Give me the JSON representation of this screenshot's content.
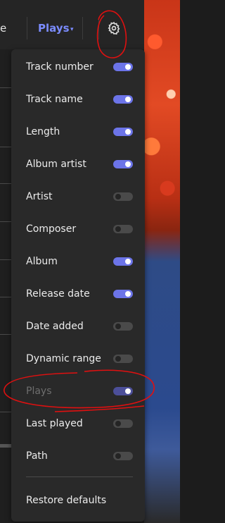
{
  "header": {
    "left_partial_label": "e",
    "sort_label": "Plays",
    "sort_arrow": "▾",
    "settings_icon": "gear-icon"
  },
  "menu": {
    "items": [
      {
        "label": "Track number",
        "on": true
      },
      {
        "label": "Track name",
        "on": true
      },
      {
        "label": "Length",
        "on": true
      },
      {
        "label": "Album artist",
        "on": true
      },
      {
        "label": "Artist",
        "on": false
      },
      {
        "label": "Composer",
        "on": false
      },
      {
        "label": "Album",
        "on": true
      },
      {
        "label": "Release date",
        "on": true
      },
      {
        "label": "Date added",
        "on": false
      },
      {
        "label": "Dynamic range",
        "on": false
      },
      {
        "label": "Plays",
        "on": true,
        "disabled": true
      },
      {
        "label": "Last played",
        "on": false
      },
      {
        "label": "Path",
        "on": false
      }
    ],
    "restore_label": "Restore defaults"
  },
  "colors": {
    "accent": "#7b8cff",
    "toggle_on": "#6c74e8",
    "annotation": "#e01010"
  }
}
